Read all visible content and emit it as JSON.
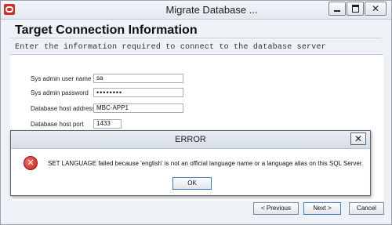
{
  "window": {
    "title": "Migrate Database ..."
  },
  "header": {
    "title": "Target Connection Information",
    "subtitle": "Enter the information required to connect to the database server"
  },
  "form": {
    "sys_admin_user_name": {
      "label": "Sys admin user name",
      "value": "sa"
    },
    "sys_admin_password": {
      "label": "Sys admin password",
      "value": "••••••••"
    },
    "database_host_address": {
      "label": "Database host address",
      "value": "MBC-APP1"
    },
    "database_host_port": {
      "label": "Database host port",
      "value": "1433"
    }
  },
  "buttons": {
    "previous": "< Previous",
    "next": "Next >",
    "cancel": "Cancel"
  },
  "error_dialog": {
    "title": "ERROR",
    "message": "SET LANGUAGE failed because 'english' is not an official language name or a language alias on this SQL Server.",
    "ok_label": "OK",
    "icon": "error-icon"
  },
  "colors": {
    "app_icon": "#d0312d",
    "error_icon": "#c8211a",
    "focus_border": "#3b7fc4"
  }
}
